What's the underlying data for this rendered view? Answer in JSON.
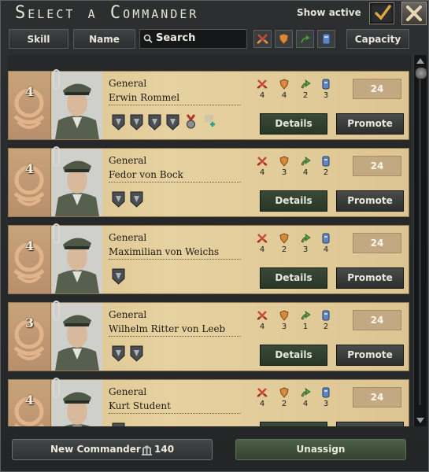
{
  "window": {
    "title": "Select a Commander",
    "show_active_label": "Show active",
    "show_active_checked": true
  },
  "filters": {
    "skill_label": "Skill",
    "name_label": "Name",
    "search_label": "Search",
    "sort_icons": [
      "attack-icon",
      "defense-icon",
      "planning-icon",
      "logistics-icon"
    ],
    "capacity_label": "Capacity"
  },
  "commanders": [
    {
      "skill": "4",
      "rank": "General",
      "name": "Erwin Rommel",
      "attack": "4",
      "defense": "4",
      "planning": "2",
      "logistics": "3",
      "capacity": "24",
      "traits": [
        "panzer-leader-trait-icon",
        "skirmisher-trait-icon",
        "desert-fox-trait-icon",
        "armor-officer-trait-icon",
        "medal-trait-icon",
        "add-trait-icon"
      ],
      "details_label": "Details",
      "promote_label": "Promote"
    },
    {
      "skill": "4",
      "rank": "General",
      "name": "Fedor von Bock",
      "attack": "4",
      "defense": "3",
      "planning": "4",
      "logistics": "2",
      "capacity": "24",
      "traits": [
        "infantry-officer-trait-icon",
        "offensive-doctrine-trait-icon"
      ],
      "details_label": "Details",
      "promote_label": "Promote"
    },
    {
      "skill": "4",
      "rank": "General",
      "name": "Maximilian von Weichs",
      "attack": "4",
      "defense": "2",
      "planning": "3",
      "logistics": "4",
      "capacity": "24",
      "traits": [
        "logistics-wizard-trait-icon"
      ],
      "details_label": "Details",
      "promote_label": "Promote"
    },
    {
      "skill": "3",
      "rank": "General",
      "name": "Wilhelm Ritter von Leeb",
      "attack": "4",
      "defense": "3",
      "planning": "1",
      "logistics": "2",
      "capacity": "24",
      "traits": [
        "defensive-doctrine-trait-icon",
        "fortress-buster-trait-icon"
      ],
      "details_label": "Details",
      "promote_label": "Promote"
    },
    {
      "skill": "4",
      "rank": "General",
      "name": "Kurt Student",
      "attack": "4",
      "defense": "2",
      "planning": "4",
      "logistics": "3",
      "capacity": "24",
      "traits": [
        "paratrooper-trait-icon"
      ],
      "details_label": "Details",
      "promote_label": "Promote"
    }
  ],
  "footer": {
    "new_commander_label": "New Commander",
    "new_commander_cost": "140",
    "unassign_label": "Unassign"
  },
  "colors": {
    "card_bg": "#e2cc9a",
    "badge_bg": "#c19c77",
    "details_green": "#34442f",
    "attack_red": "#c64a3a",
    "defense_orange": "#d8893a",
    "planning_green": "#58a14a",
    "logistics_blue": "#5d86c2"
  }
}
